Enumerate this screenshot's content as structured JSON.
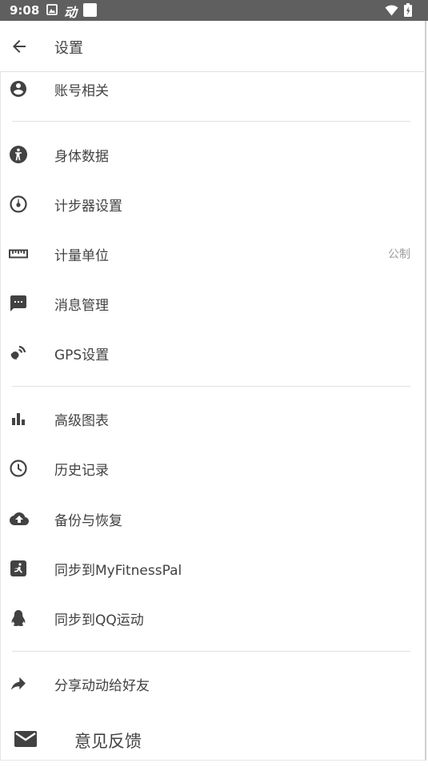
{
  "status_bar": {
    "time": "9:08",
    "app_glyph": "动"
  },
  "app_bar": {
    "title": "设置"
  },
  "settings": {
    "account": "账号相关",
    "body_data": "身体数据",
    "pedometer": "计步器设置",
    "units": "计量单位",
    "units_value": "公制",
    "messages": "消息管理",
    "gps": "GPS设置",
    "charts": "高级图表",
    "history": "历史记录",
    "backup": "备份与恢复",
    "myfitnesspal": "同步到MyFitnessPal",
    "qq": "同步到QQ运动",
    "share": "分享动动给好友",
    "feedback": "意见反馈"
  },
  "colors": {
    "status_bar": "#5f5f5f",
    "icon": "#424242",
    "divider": "#e0e0e0",
    "secondary_text": "#9e9e9e"
  }
}
